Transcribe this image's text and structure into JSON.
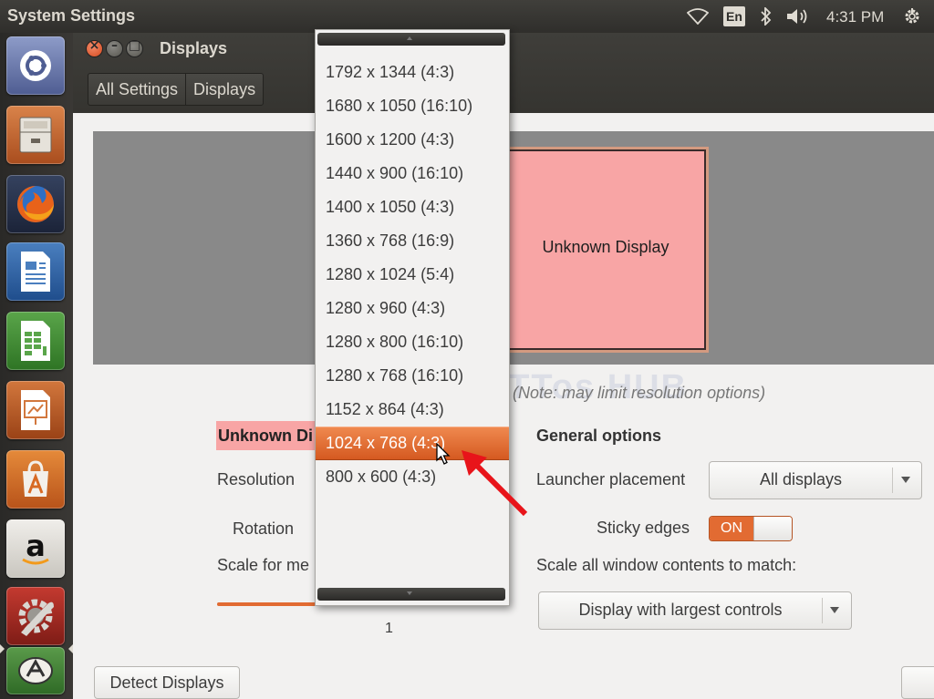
{
  "panel": {
    "app_title": "System Settings",
    "lang": "En",
    "clock": "4:31 PM",
    "icons": [
      "wifi-icon",
      "bluetooth-icon",
      "volume-icon",
      "power-gear-icon"
    ]
  },
  "launcher": {
    "items": [
      "dash-home",
      "files",
      "firefox",
      "libreoffice-writer",
      "libreoffice-calc",
      "libreoffice-impress",
      "ubuntu-software-center",
      "amazon",
      "system-settings",
      "software-updater"
    ]
  },
  "window": {
    "title": "Displays",
    "breadcrumb": [
      "All Settings",
      "Displays"
    ]
  },
  "preview": {
    "monitor_label": "Unknown Display"
  },
  "watermark": "TTTos HUB",
  "note": "(Note: may limit resolution options)",
  "monitor_options": {
    "heading": "Unknown Di",
    "resolution_label": "Resolution",
    "rotation_label": "Rotation",
    "scale_label": "Scale for me",
    "scale_value": "1",
    "scale_fraction": 0.46
  },
  "general": {
    "heading": "General options",
    "launcher_label": "Launcher placement",
    "launcher_value": "All displays",
    "sticky_label": "Sticky edges",
    "sticky_state": "ON",
    "scale_all_label": "Scale all window contents to match:",
    "scale_all_value": "Display with largest controls"
  },
  "buttons": {
    "detect": "Detect Displays"
  },
  "resolution_menu": {
    "selected_index": 11,
    "options": [
      "1792 x 1344 (4:3)",
      "1680 x 1050 (16:10)",
      "1600 x 1200 (4:3)",
      "1440 x 900 (16:10)",
      "1400 x 1050 (4:3)",
      "1360 x 768 (16:9)",
      "1280 x 1024 (5:4)",
      "1280 x 960 (4:3)",
      "1280 x 800 (16:10)",
      "1280 x 768 (16:10)",
      "1152 x 864 (4:3)",
      "1024 x 768 (4:3)",
      "800 x 600 (4:3)"
    ]
  },
  "colors": {
    "accent": "#e26b32",
    "monitor_fill": "#f8a5a5",
    "annotation_arrow": "#e8141a"
  }
}
